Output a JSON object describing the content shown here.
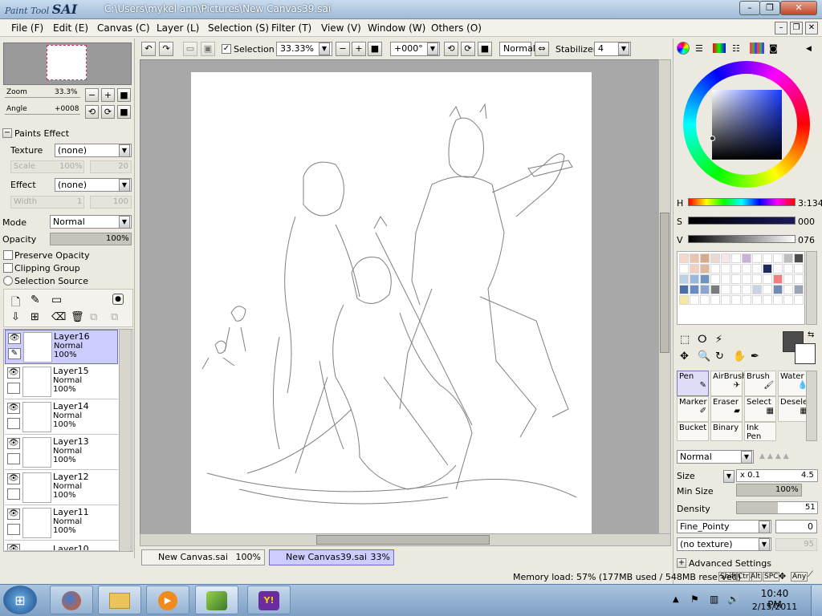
{
  "window": {
    "app_name": "Paint Tool",
    "app_short": "SAI",
    "path": "C:\\Users\\mykel ann\\Pictures\\New Canvas39.sai"
  },
  "menu": [
    "File (F)",
    "Edit (E)",
    "Canvas (C)",
    "Layer (L)",
    "Selection (S)",
    "Filter (T)",
    "View (V)",
    "Window (W)",
    "Others (O)"
  ],
  "toolbar": {
    "selection_label": "Selection",
    "zoom": "33.33%",
    "rotation": "+000°",
    "blend_mode": "Normal",
    "stabilizer_label": "Stabilizer",
    "stabilizer_value": "4"
  },
  "navigator": {
    "zoom_label": "Zoom",
    "zoom_value": "33.3%",
    "angle_label": "Angle",
    "angle_value": "+0008"
  },
  "paints_effect": {
    "header": "Paints Effect",
    "texture_label": "Texture",
    "texture_value": "(none)",
    "scale_label": "Scale",
    "scale_value": "100%",
    "scale_num": "20",
    "effect_label": "Effect",
    "effect_value": "(none)",
    "width_label": "Width",
    "width_value": "1",
    "width_num": "100"
  },
  "layer_props": {
    "mode_label": "Mode",
    "mode_value": "Normal",
    "opacity_label": "Opacity",
    "opacity_value": "100%",
    "opacity_fill": 1.0,
    "preserve_opacity": "Preserve Opacity",
    "clipping_group": "Clipping Group",
    "selection_source": "Selection Source"
  },
  "layers": [
    {
      "name": "Layer16",
      "mode": "Normal",
      "opacity": "100%"
    },
    {
      "name": "Layer15",
      "mode": "Normal",
      "opacity": "100%"
    },
    {
      "name": "Layer14",
      "mode": "Normal",
      "opacity": "100%"
    },
    {
      "name": "Layer13",
      "mode": "Normal",
      "opacity": "100%"
    },
    {
      "name": "Layer12",
      "mode": "Normal",
      "opacity": "100%"
    },
    {
      "name": "Layer11",
      "mode": "Normal",
      "opacity": "100%"
    },
    {
      "name": "Layer10",
      "mode": "",
      "opacity": ""
    }
  ],
  "tabs": [
    {
      "name": "New Canvas.sai",
      "zoom": "100%"
    },
    {
      "name": "New Canvas39.sai",
      "zoom": "33%"
    }
  ],
  "color": {
    "h_label": "H",
    "h_value": "3:134",
    "s_label": "S",
    "s_value": "000",
    "v_label": "V",
    "v_value": "076",
    "main_color": "#4c4c4c",
    "swatches": [
      "#f4d9c8",
      "#e9c4b0",
      "#d7a98f",
      "#ead9d3",
      "#f6e6e6",
      "#ffffff",
      "#c9b2d6",
      "#ffffff",
      "#ffffff",
      "#ffffff",
      "#bdbdbd",
      "#4c4c4c",
      "#ffffff",
      "#f0d0c0",
      "#e0b8a0",
      "#ffffff",
      "#ffffff",
      "#ffffff",
      "#ffffff",
      "#ffffff",
      "#1c2a5c",
      "#ffffff",
      "#ffffff",
      "#ffffff",
      "#bcd0e6",
      "#9ab8dc",
      "#6f94c4",
      "#ffffff",
      "#ffffff",
      "#ffffff",
      "#ffffff",
      "#ffffff",
      "#ffffff",
      "#f08080",
      "#ffffff",
      "#ffffff",
      "#4b6ea8",
      "#6b8cc2",
      "#8aa6cf",
      "#7a7a7a",
      "#ffffff",
      "#ffffff",
      "#ffffff",
      "#c8d4e4",
      "#ffffff",
      "#6d8cb8",
      "#ffffff",
      "#9aa4b4",
      "#f4e9a2",
      "#ffffff",
      "#ffffff",
      "#ffffff",
      "#ffffff",
      "#ffffff",
      "#ffffff",
      "#ffffff",
      "#ffffff",
      "#ffffff",
      "#ffffff",
      "#ffffff"
    ]
  },
  "tools": [
    {
      "name": "Pen",
      "active": true
    },
    {
      "name": "AirBrush",
      "active": false
    },
    {
      "name": "Brush",
      "active": false
    },
    {
      "name": "Water",
      "active": false
    },
    {
      "name": "Marker",
      "active": false
    },
    {
      "name": "Eraser",
      "active": false
    },
    {
      "name": "Select",
      "active": false
    },
    {
      "name": "Deselect",
      "active": false
    },
    {
      "name": "Bucket",
      "active": false
    },
    {
      "name": "Binary",
      "active": false
    },
    {
      "name": "Ink Pen",
      "active": false
    }
  ],
  "brush": {
    "mode": "Normal",
    "size_label": "Size",
    "size_mult": "x 0.1",
    "size_value": "4.5",
    "min_size_label": "Min Size",
    "min_size_value": "100%",
    "min_size_fill": 1.0,
    "density_label": "Density",
    "density_value": "51",
    "density_fill": 0.51,
    "shape": "Fine_Pointy",
    "shape_value": "0",
    "texture": "(no texture)",
    "texture_value": "95",
    "advanced": "Advanced Settings"
  },
  "status": {
    "memory": "Memory load: 57% (177MB used / 548MB reserved)",
    "keys": [
      "Shift",
      "Ctrl",
      "Alt",
      "SPC",
      "Any"
    ]
  },
  "taskbar": {
    "time": "10:40 PM",
    "date": "2/15/2011"
  }
}
